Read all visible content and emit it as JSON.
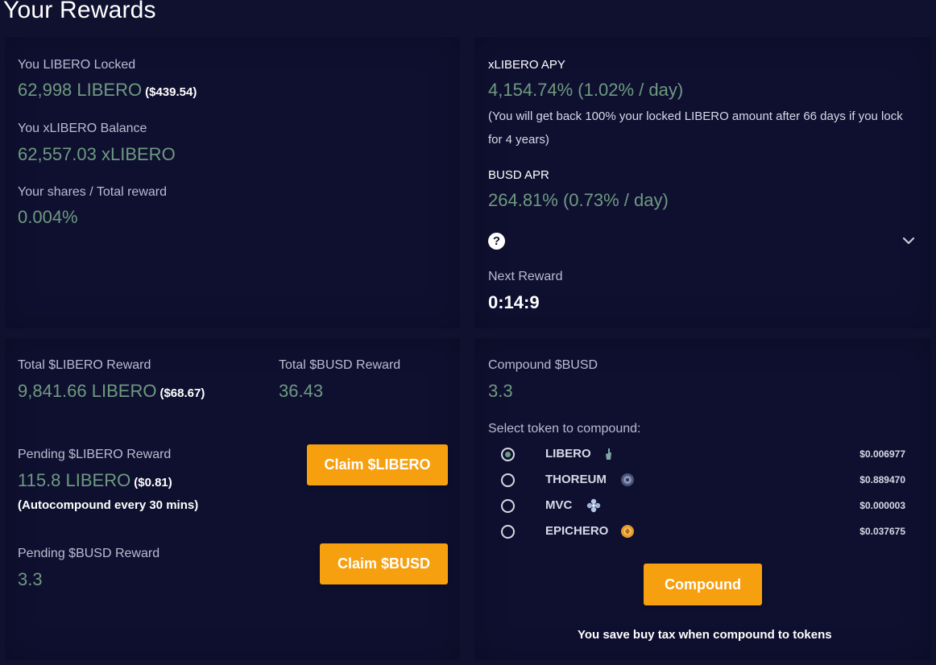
{
  "page_title": "Your Rewards",
  "locked": {
    "label": "You LIBERO Locked",
    "value": "62,998 LIBERO",
    "usd": "($439.54)"
  },
  "xbalance": {
    "label": "You xLIBERO Balance",
    "value": "62,557.03 xLIBERO"
  },
  "shares": {
    "label": "Your shares / Total reward",
    "value": "0.004%"
  },
  "apy": {
    "label": "xLIBERO APY",
    "value": "4,154.74% (1.02% / day)",
    "note": "(You will get back 100% your locked LIBERO amount after 66 days if you lock for 4 years)"
  },
  "apr": {
    "label": "BUSD APR",
    "value": "264.81% (0.73% / day)"
  },
  "help_glyph": "?",
  "next_reward": {
    "label": "Next Reward",
    "value": "0:14:9"
  },
  "total_libero": {
    "label": "Total $LIBERO Reward",
    "value": "9,841.66 LIBERO",
    "usd": "($68.67)"
  },
  "total_busd": {
    "label": "Total $BUSD Reward",
    "value": "36.43"
  },
  "pending_libero": {
    "label": "Pending $LIBERO Reward",
    "value": "115.8 LIBERO",
    "usd": "($0.81)",
    "note": "(Autocompound every 30 mins)",
    "button": "Claim $LIBERO"
  },
  "pending_busd": {
    "label": "Pending $BUSD Reward",
    "value": "3.3",
    "button": "Claim $BUSD"
  },
  "compound": {
    "label": "Compound $BUSD",
    "value": "3.3",
    "select_label": "Select token to compound:",
    "tokens": [
      {
        "name": "LIBERO",
        "price": "$0.006977",
        "selected": true,
        "icon": "statue-icon",
        "color": "#7fa7a0"
      },
      {
        "name": "THOREUM",
        "price": "$0.889470",
        "selected": false,
        "icon": "thoreum-icon",
        "color": "#8a95b8"
      },
      {
        "name": "MVC",
        "price": "$0.000003",
        "selected": false,
        "icon": "mvc-icon",
        "color": "#b7c7e6"
      },
      {
        "name": "EPICHERO",
        "price": "$0.037675",
        "selected": false,
        "icon": "epichero-icon",
        "color": "#e39a2e"
      }
    ],
    "button": "Compound",
    "footer": "You save buy tax when compound to tokens"
  },
  "colors": {
    "accent": "#f7a00f",
    "value_green": "#6e9a80",
    "background": "#10112f"
  }
}
